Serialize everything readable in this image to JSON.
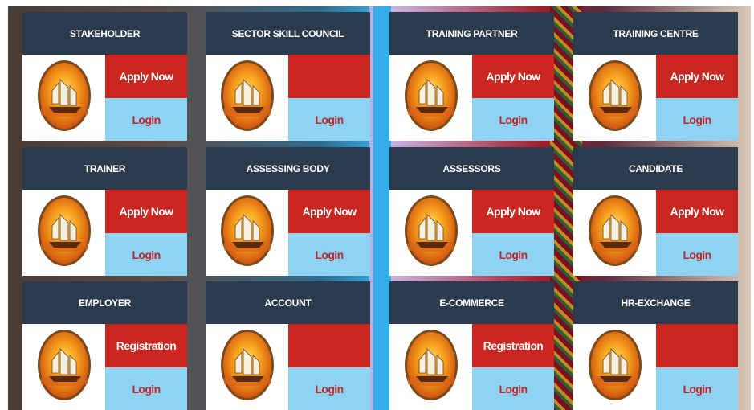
{
  "cards": [
    {
      "title": "STAKEHOLDER",
      "apply": "Apply Now",
      "login": "Login"
    },
    {
      "title": "SECTOR SKILL COUNCIL",
      "apply": "",
      "login": "Login"
    },
    {
      "title": "TRAINING PARTNER",
      "apply": "Apply Now",
      "login": "Login"
    },
    {
      "title": "TRAINING CENTRE",
      "apply": "Apply Now",
      "login": "Login"
    },
    {
      "title": "TRAINER",
      "apply": "Apply Now",
      "login": "Login"
    },
    {
      "title": "ASSESSING BODY",
      "apply": "Apply Now",
      "login": "Login"
    },
    {
      "title": "ASSESSORS",
      "apply": "Apply Now",
      "login": "Login"
    },
    {
      "title": "CANDIDATE",
      "apply": "Apply Now",
      "login": "Login"
    },
    {
      "title": "EMPLOYER",
      "apply": "Registration",
      "login": "Login"
    },
    {
      "title": "ACCOUNT",
      "apply": "",
      "login": "Login"
    },
    {
      "title": "E-COMMERCE",
      "apply": "Registration",
      "login": "Login"
    },
    {
      "title": "HR-EXCHANGE",
      "apply": "",
      "login": "Login"
    }
  ],
  "icons": {
    "logo": "sailing-ship-sunset-logo"
  },
  "colors": {
    "header": "#2b3a4d",
    "apply": "#c9271f",
    "login": "#8fd3f2",
    "login_text": "#c0272d"
  }
}
